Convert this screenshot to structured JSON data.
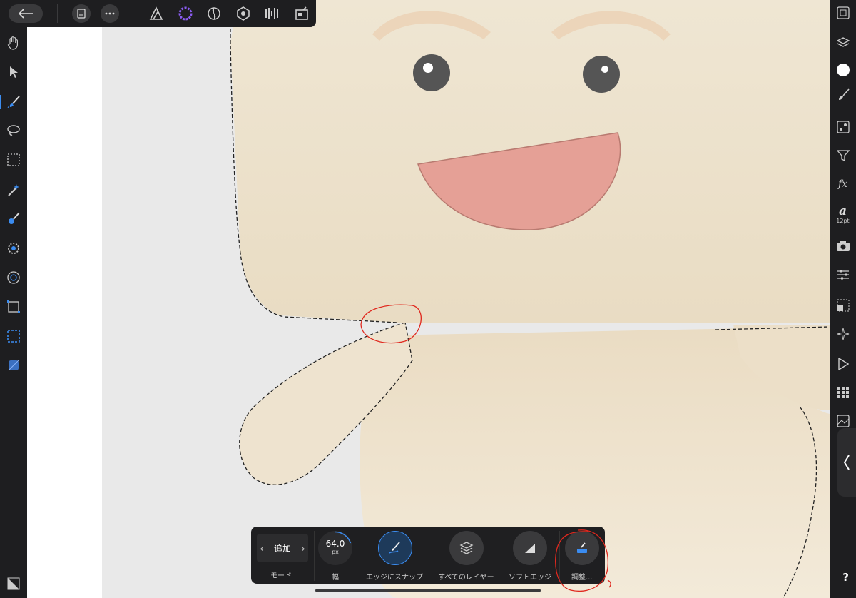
{
  "top_toolbar": {
    "items": [
      "back-arrow-icon",
      "document-icon",
      "more-icon",
      "photo-persona-icon",
      "selection-persona-icon",
      "liquify-persona-icon",
      "develop-persona-icon",
      "tone-mapping-persona-icon",
      "export-persona-icon"
    ]
  },
  "left_tools": [
    "hand-icon",
    "move-icon",
    "selection-brush-icon",
    "freehand-selection-icon",
    "marquee-icon",
    "flood-select-icon",
    "paint-brush-icon",
    "burn-dodge-icon",
    "healing-icon",
    "crop-icon",
    "rectangle-selection-icon",
    "gradient-icon",
    "fill-icon"
  ],
  "right_panel": {
    "items": [
      "navigator-icon",
      "layers-icon",
      "color-icon",
      "brushes-icon",
      "swatches-icon",
      "channels-icon",
      "fx-icon",
      "text-styles-icon",
      "camera-icon",
      "adjustments-icon",
      "transform-icon",
      "history-icon",
      "macro-icon",
      "grid-icon",
      "stock-icon"
    ],
    "text_style_size": "12pt",
    "text_style_glyph": "a",
    "fx_label": "fx",
    "help": "?"
  },
  "context_toolbar": {
    "mode": {
      "value": "追加",
      "label": "モード"
    },
    "width": {
      "value": "64.0",
      "unit": "px",
      "label": "幅",
      "progress": 0.2
    },
    "snap_to_edges": {
      "label": "エッジにスナップ",
      "active": true
    },
    "all_layers": {
      "label": "すべてのレイヤー",
      "active": false
    },
    "soft_edges": {
      "label": "ソフトエッジ",
      "active": false
    },
    "refine": {
      "label": "調整..."
    }
  },
  "colors": {
    "accent": "#3b8cf0",
    "character": "#eee3cf",
    "mouth": "#e5a096",
    "annotation": "#e0281e"
  }
}
